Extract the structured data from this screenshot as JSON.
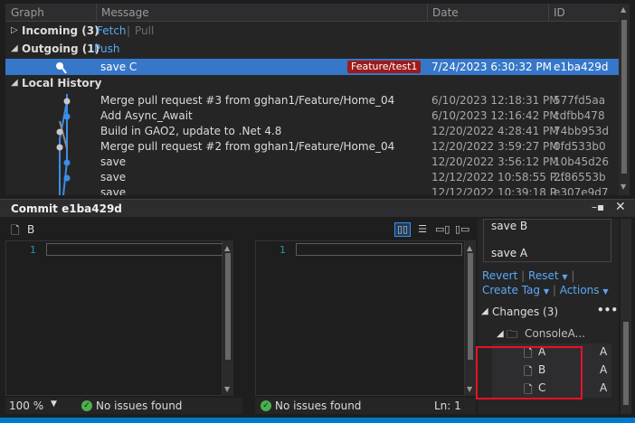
{
  "header": {
    "graph": "Graph",
    "message": "Message",
    "date": "Date",
    "id": "ID"
  },
  "incoming": {
    "label": "Incoming (3)",
    "fetch": "Fetch",
    "sep": "|",
    "pull": "Pull"
  },
  "outgoing": {
    "label": "Outgoing (1)",
    "push": "Push"
  },
  "outgoing_row": {
    "message": "save C",
    "branch": "Feature/test1",
    "date": "7/24/2023 6:30:32 PM",
    "id": "e1ba429d"
  },
  "local_history": {
    "label": "Local History"
  },
  "history": [
    {
      "message": "Merge pull request #3 from gghan1/Feature/Home_04",
      "date": "6/10/2023 12:18:31 PM",
      "id": "577fd5aa"
    },
    {
      "message": "Add Async_Await",
      "date": "6/10/2023 12:16:42 PM",
      "id": "cdfbb478"
    },
    {
      "message": "Build in GAO2, update to .Net 4.8",
      "date": "12/20/2022 4:28:41 PM",
      "id": "74bb953d"
    },
    {
      "message": "Merge pull request #2 from gghan1/Feature/Home_04",
      "date": "12/20/2022 3:59:27 PM",
      "id": "0fd533b0"
    },
    {
      "message": "save",
      "date": "12/20/2022 3:56:12 PM",
      "id": "10b45d26"
    },
    {
      "message": "save",
      "date": "12/12/2022 10:58:55 P...",
      "id": "2f86553b"
    },
    {
      "message": "save",
      "date": "12/12/2022 10:39:18 P...",
      "id": "e307e9d7"
    }
  ],
  "commit": {
    "title": "Commit e1ba429d",
    "pin": "–▪",
    "close": "✕"
  },
  "diff": {
    "file_name": "B",
    "left_line": "1",
    "right_line": "1",
    "zoom": "100 %",
    "left_status": "No issues found",
    "right_status": "No issues found",
    "ln": "Ln: 1"
  },
  "commits_list": [
    "save B",
    "save A"
  ],
  "actions": {
    "revert": "Revert",
    "reset": "Reset",
    "create_tag": "Create Tag",
    "actions": "Actions"
  },
  "changes": {
    "label": "Changes (3)",
    "more": "•••",
    "folder": "ConsoleA...",
    "files": [
      {
        "name": "A",
        "status": "A"
      },
      {
        "name": "B",
        "status": "A"
      },
      {
        "name": "C",
        "status": "A"
      }
    ]
  },
  "colors": {
    "accent": "#3677ca",
    "branch_badge": "#9c1b1b",
    "link": "#5aa9f5",
    "highlight_box": "#e81123"
  },
  "icons": [
    "expand-arrow-icon",
    "graph-node-icon",
    "file-icon",
    "folder-icon",
    "check-circle-icon",
    "close-icon",
    "pin-icon"
  ]
}
